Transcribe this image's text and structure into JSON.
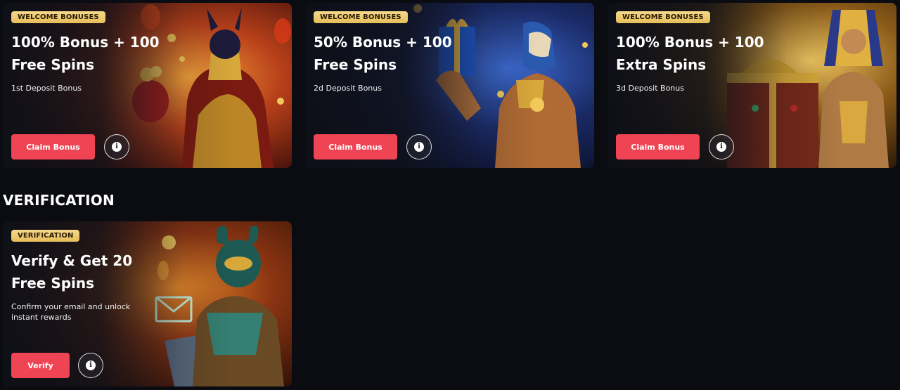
{
  "welcome_cards": [
    {
      "badge": "WELCOME BONUSES",
      "title_line1": "100% Bonus + 100",
      "title_line2": "Free Spins",
      "subtitle": "1st Deposit Bonus",
      "button_label": "Claim Bonus",
      "info_icon": "info-icon",
      "art": "anubis-with-gold-sack",
      "theme_colors": [
        "#7a1e10",
        "#e07a1e",
        "#f4b33c"
      ]
    },
    {
      "badge": "WELCOME BONUSES",
      "title_line1": "50% Bonus + 100",
      "title_line2": "Free Spins",
      "subtitle": "2d Deposit Bonus",
      "button_label": "Claim Bonus",
      "info_icon": "info-icon",
      "art": "horus-holding-gift-box",
      "theme_colors": [
        "#0f1a44",
        "#2a56b8",
        "#d9a441"
      ]
    },
    {
      "badge": "WELCOME BONUSES",
      "title_line1": "100% Bonus + 100",
      "title_line2": "Extra Spins",
      "subtitle": "3d Deposit Bonus",
      "button_label": "Claim Bonus",
      "info_icon": "info-icon",
      "art": "pharaoh-with-treasure-chest",
      "theme_colors": [
        "#3a2206",
        "#b8861e",
        "#f2c85a"
      ]
    }
  ],
  "verification_section": {
    "heading": "VERIFICATION",
    "card": {
      "badge": "VERIFICATION",
      "title_line1": "Verify & Get 20",
      "title_line2": "Free Spins",
      "subtitle": "Confirm your email and unlock instant rewards",
      "button_label": "Verify",
      "info_icon": "info-icon",
      "art": "scarab-warrior-with-tablet-and-envelope",
      "theme_colors": [
        "#3a1608",
        "#c4621a",
        "#3fb8a8"
      ]
    }
  },
  "colors": {
    "page_background": "#0a0c12",
    "button": "#ef4453",
    "badge": "#e6bd5a"
  }
}
